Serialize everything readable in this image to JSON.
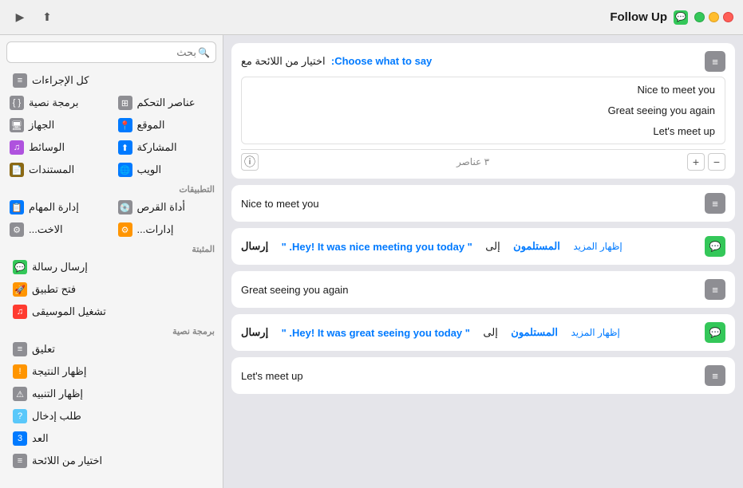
{
  "topbar": {
    "title": "Follow Up",
    "play_label": "▶",
    "share_label": "⬆",
    "info_label": "ⓘ"
  },
  "sidebar": {
    "search_placeholder": "بحث",
    "all_actions_label": "كل الإجراءات",
    "items_grid": [
      {
        "id": "scripting",
        "label": "برمجة نصية",
        "icon": "{ }"
      },
      {
        "id": "hardware",
        "label": "الجهاز",
        "icon": "🖥"
      },
      {
        "id": "media",
        "label": "الوسائط",
        "icon": "🎵"
      },
      {
        "id": "docs",
        "label": "المستندات",
        "icon": "📄"
      },
      {
        "id": "controls",
        "label": "عناصر التحكم",
        "icon": "⊞"
      },
      {
        "id": "location",
        "label": "الموقع",
        "icon": "📍"
      },
      {
        "id": "sharing",
        "label": "المشاركة",
        "icon": "⬆"
      },
      {
        "id": "web",
        "label": "الويب",
        "icon": "🌐"
      }
    ],
    "apps_section": "التطبيقات",
    "apps": [
      {
        "id": "task-mgr",
        "label": "إدارة المهام",
        "icon": "📋"
      },
      {
        "id": "disk-tool",
        "label": "أداة القرص",
        "icon": "💿"
      },
      {
        "id": "admin1",
        "label": "الاخت...",
        "icon": "⚙"
      },
      {
        "id": "admin2",
        "label": "إدارات...",
        "icon": "⚙"
      }
    ],
    "favorites_section": "المثبتة",
    "favorites": [
      {
        "id": "send-msg",
        "label": "إرسال رسالة",
        "icon": "💬",
        "icon_color": "green"
      },
      {
        "id": "open-app",
        "label": "فتح تطبيق",
        "icon": "🚀",
        "icon_color": "orange"
      },
      {
        "id": "play-music",
        "label": "تشغيل الموسيقى",
        "icon": "♫",
        "icon_color": "red"
      }
    ],
    "scripting_section": "برمجة نصية",
    "scripting_items": [
      {
        "id": "comment",
        "label": "تعليق",
        "icon": "≡"
      },
      {
        "id": "show-result",
        "label": "إظهار النتيجة",
        "icon": "!"
      },
      {
        "id": "show-alert",
        "label": "إظهار التنبيه",
        "icon": "⚠"
      },
      {
        "id": "ask-input",
        "label": "طلب إدخال",
        "icon": "?"
      },
      {
        "id": "count",
        "label": "العد",
        "icon": "3"
      },
      {
        "id": "choose-list",
        "label": "اختيار من اللائحة",
        "icon": "≡"
      }
    ]
  },
  "content": {
    "card1": {
      "header_label": "اختيار من اللائحة مع",
      "choose_label": "Choose what to say:",
      "options": [
        "Nice to meet you",
        "Great seeing you again",
        "Let's meet up"
      ],
      "element_count": "٣ عناصر",
      "minus_label": "−",
      "plus_label": "+"
    },
    "card2": {
      "label": "Nice to meet you"
    },
    "card3": {
      "send_label": "إرسال",
      "message": "\" Hey! It was nice meeting you today. \"",
      "to_label": "إلى",
      "recipients": "المستلمون",
      "more_label": "إظهار المزيد"
    },
    "card4": {
      "label": "Great seeing you again"
    },
    "card5": {
      "send_label": "إرسال",
      "message": "\" Hey! It was great seeing you today. \"",
      "to_label": "إلى",
      "recipients": "المستلمون",
      "more_label": "إظهار المزيد"
    },
    "card6": {
      "label": "Let's meet up"
    }
  }
}
